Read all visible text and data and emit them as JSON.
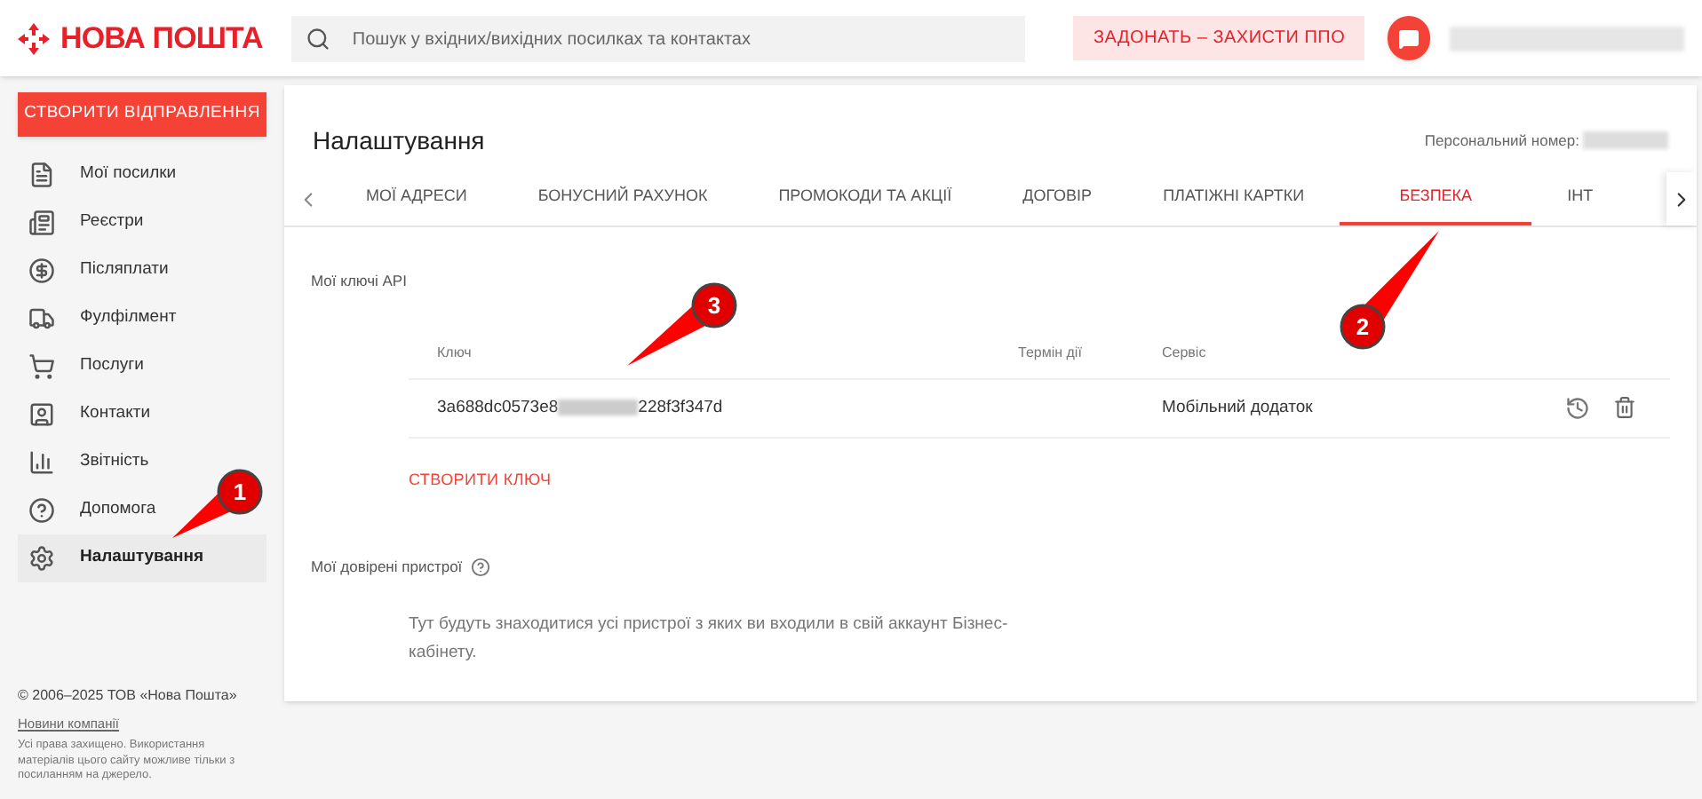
{
  "header": {
    "logo_text": "НОВА ПОШТА",
    "search": {
      "placeholder": "Пошук у вхідних/вихідних посилках та контактах"
    },
    "donate_button": "ЗАДОНАТЬ – ЗАХИСТИ ППО"
  },
  "sidebar": {
    "create_button": "СТВОРИТИ ВІДПРАВЛЕННЯ",
    "items": [
      {
        "label": "Мої посилки",
        "selected": false
      },
      {
        "label": "Реєстри",
        "selected": false
      },
      {
        "label": "Післяплати",
        "selected": false
      },
      {
        "label": "Фулфілмент",
        "selected": false
      },
      {
        "label": "Послуги",
        "selected": false
      },
      {
        "label": "Контакти",
        "selected": false
      },
      {
        "label": "Звітність",
        "selected": false
      },
      {
        "label": "Допомога",
        "selected": false
      },
      {
        "label": "Налаштування",
        "selected": true
      }
    ],
    "footer": {
      "copyright": "© 2006–2025 ТОВ «Нова Пошта»",
      "link": "Новини компанії",
      "note": "Усі права захищено. Використання матеріалів цього сайту можливе тільки з посиланням на джерело."
    }
  },
  "page": {
    "title": "Налаштування",
    "personal_number_label": "Персональний номер:",
    "tabs": [
      {
        "label": "МОЇ АДРЕСИ",
        "selected": false
      },
      {
        "label": "БОНУСНИЙ РАХУНОК",
        "selected": false
      },
      {
        "label": "ПРОМОКОДИ ТА АКЦІЇ",
        "selected": false
      },
      {
        "label": "ДОГОВІР",
        "selected": false
      },
      {
        "label": "ПЛАТІЖНІ КАРТКИ",
        "selected": false
      },
      {
        "label": "БЕЗПЕКА",
        "selected": true
      },
      {
        "label": "ІНТ",
        "selected": false
      }
    ],
    "api_keys": {
      "title": "Мої ключі API",
      "columns": [
        "Ключ",
        "Термін дії",
        "Сервіс"
      ],
      "rows": [
        {
          "key_start": "3a688dc0573e8",
          "key_end": "228f3f347d",
          "service": "Мобільний додаток"
        }
      ],
      "create_button": "СТВОРИТИ КЛЮЧ"
    },
    "trusted_devices": {
      "title": "Мої довірені пристрої",
      "empty_text": "Тут будуть знаходитися усі пристрої з яких ви входили в свій аккаунт Бізнес-кабінету."
    }
  },
  "annotations": [
    {
      "label": "1"
    },
    {
      "label": "2"
    },
    {
      "label": "3"
    }
  ]
}
